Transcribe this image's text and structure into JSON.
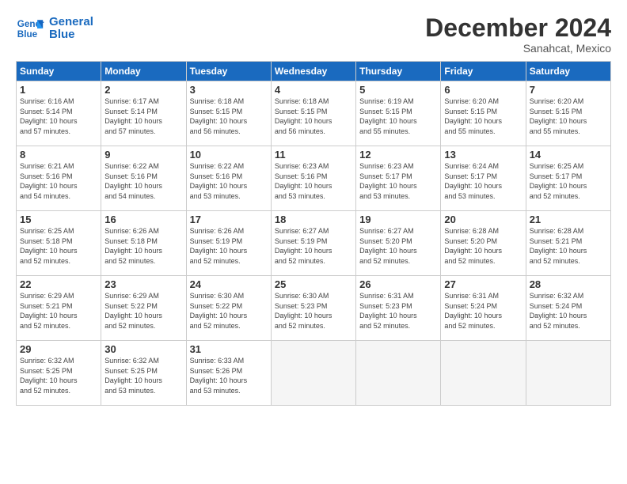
{
  "logo": {
    "line1": "General",
    "line2": "Blue"
  },
  "title": "December 2024",
  "subtitle": "Sanahcat, Mexico",
  "headers": [
    "Sunday",
    "Monday",
    "Tuesday",
    "Wednesday",
    "Thursday",
    "Friday",
    "Saturday"
  ],
  "weeks": [
    [
      {
        "day": "1",
        "info": "Sunrise: 6:16 AM\nSunset: 5:14 PM\nDaylight: 10 hours\nand 57 minutes."
      },
      {
        "day": "2",
        "info": "Sunrise: 6:17 AM\nSunset: 5:14 PM\nDaylight: 10 hours\nand 57 minutes."
      },
      {
        "day": "3",
        "info": "Sunrise: 6:18 AM\nSunset: 5:15 PM\nDaylight: 10 hours\nand 56 minutes."
      },
      {
        "day": "4",
        "info": "Sunrise: 6:18 AM\nSunset: 5:15 PM\nDaylight: 10 hours\nand 56 minutes."
      },
      {
        "day": "5",
        "info": "Sunrise: 6:19 AM\nSunset: 5:15 PM\nDaylight: 10 hours\nand 55 minutes."
      },
      {
        "day": "6",
        "info": "Sunrise: 6:20 AM\nSunset: 5:15 PM\nDaylight: 10 hours\nand 55 minutes."
      },
      {
        "day": "7",
        "info": "Sunrise: 6:20 AM\nSunset: 5:15 PM\nDaylight: 10 hours\nand 55 minutes."
      }
    ],
    [
      {
        "day": "8",
        "info": "Sunrise: 6:21 AM\nSunset: 5:16 PM\nDaylight: 10 hours\nand 54 minutes."
      },
      {
        "day": "9",
        "info": "Sunrise: 6:22 AM\nSunset: 5:16 PM\nDaylight: 10 hours\nand 54 minutes."
      },
      {
        "day": "10",
        "info": "Sunrise: 6:22 AM\nSunset: 5:16 PM\nDaylight: 10 hours\nand 53 minutes."
      },
      {
        "day": "11",
        "info": "Sunrise: 6:23 AM\nSunset: 5:16 PM\nDaylight: 10 hours\nand 53 minutes."
      },
      {
        "day": "12",
        "info": "Sunrise: 6:23 AM\nSunset: 5:17 PM\nDaylight: 10 hours\nand 53 minutes."
      },
      {
        "day": "13",
        "info": "Sunrise: 6:24 AM\nSunset: 5:17 PM\nDaylight: 10 hours\nand 53 minutes."
      },
      {
        "day": "14",
        "info": "Sunrise: 6:25 AM\nSunset: 5:17 PM\nDaylight: 10 hours\nand 52 minutes."
      }
    ],
    [
      {
        "day": "15",
        "info": "Sunrise: 6:25 AM\nSunset: 5:18 PM\nDaylight: 10 hours\nand 52 minutes."
      },
      {
        "day": "16",
        "info": "Sunrise: 6:26 AM\nSunset: 5:18 PM\nDaylight: 10 hours\nand 52 minutes."
      },
      {
        "day": "17",
        "info": "Sunrise: 6:26 AM\nSunset: 5:19 PM\nDaylight: 10 hours\nand 52 minutes."
      },
      {
        "day": "18",
        "info": "Sunrise: 6:27 AM\nSunset: 5:19 PM\nDaylight: 10 hours\nand 52 minutes."
      },
      {
        "day": "19",
        "info": "Sunrise: 6:27 AM\nSunset: 5:20 PM\nDaylight: 10 hours\nand 52 minutes."
      },
      {
        "day": "20",
        "info": "Sunrise: 6:28 AM\nSunset: 5:20 PM\nDaylight: 10 hours\nand 52 minutes."
      },
      {
        "day": "21",
        "info": "Sunrise: 6:28 AM\nSunset: 5:21 PM\nDaylight: 10 hours\nand 52 minutes."
      }
    ],
    [
      {
        "day": "22",
        "info": "Sunrise: 6:29 AM\nSunset: 5:21 PM\nDaylight: 10 hours\nand 52 minutes."
      },
      {
        "day": "23",
        "info": "Sunrise: 6:29 AM\nSunset: 5:22 PM\nDaylight: 10 hours\nand 52 minutes."
      },
      {
        "day": "24",
        "info": "Sunrise: 6:30 AM\nSunset: 5:22 PM\nDaylight: 10 hours\nand 52 minutes."
      },
      {
        "day": "25",
        "info": "Sunrise: 6:30 AM\nSunset: 5:23 PM\nDaylight: 10 hours\nand 52 minutes."
      },
      {
        "day": "26",
        "info": "Sunrise: 6:31 AM\nSunset: 5:23 PM\nDaylight: 10 hours\nand 52 minutes."
      },
      {
        "day": "27",
        "info": "Sunrise: 6:31 AM\nSunset: 5:24 PM\nDaylight: 10 hours\nand 52 minutes."
      },
      {
        "day": "28",
        "info": "Sunrise: 6:32 AM\nSunset: 5:24 PM\nDaylight: 10 hours\nand 52 minutes."
      }
    ],
    [
      {
        "day": "29",
        "info": "Sunrise: 6:32 AM\nSunset: 5:25 PM\nDaylight: 10 hours\nand 52 minutes."
      },
      {
        "day": "30",
        "info": "Sunrise: 6:32 AM\nSunset: 5:25 PM\nDaylight: 10 hours\nand 53 minutes."
      },
      {
        "day": "31",
        "info": "Sunrise: 6:33 AM\nSunset: 5:26 PM\nDaylight: 10 hours\nand 53 minutes."
      },
      null,
      null,
      null,
      null
    ]
  ]
}
